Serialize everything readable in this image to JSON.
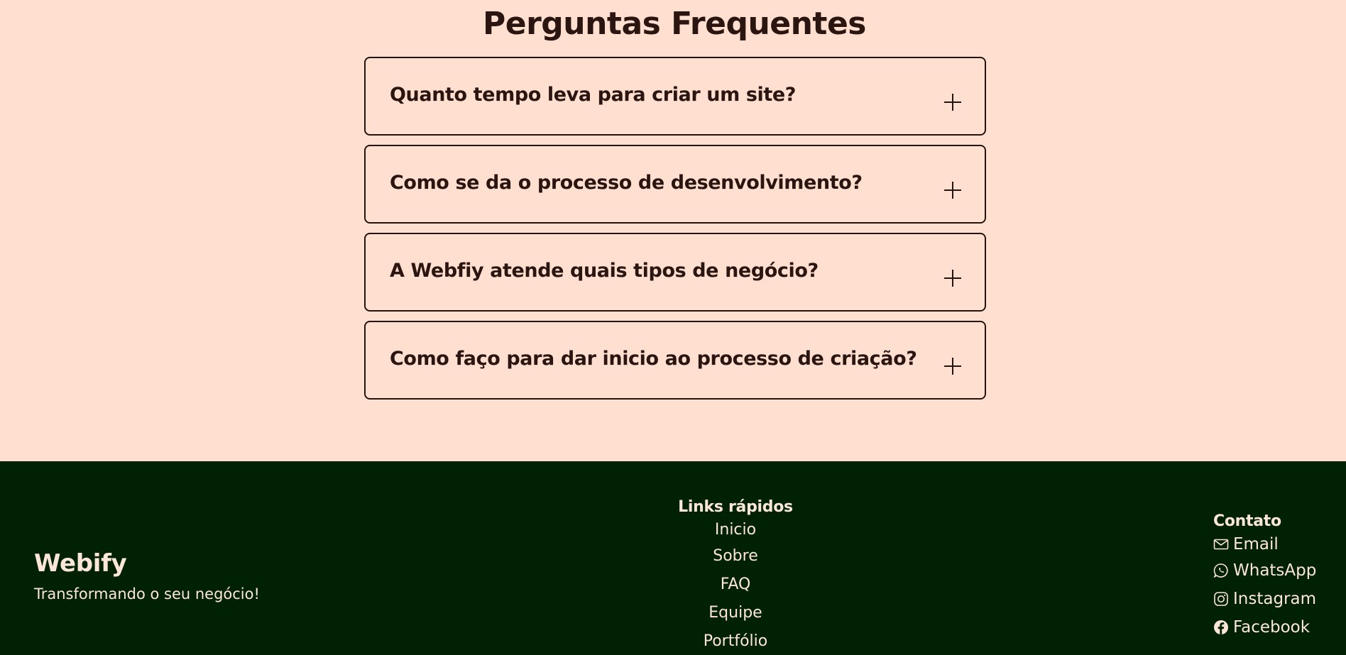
{
  "faq": {
    "title": "Perguntas Frequentes",
    "items": [
      {
        "question": "Quanto tempo leva para criar um site?",
        "icon": "plus-icon"
      },
      {
        "question": "Como se da o processo de desenvolvimento?",
        "icon": "plus-icon"
      },
      {
        "question": "A Webfiy atende quais tipos de negócio?",
        "icon": "plus-icon"
      },
      {
        "question": "Como faço para dar inicio ao processo de criação?",
        "icon": "plus-icon"
      }
    ]
  },
  "footer": {
    "brand": {
      "name": "Webify",
      "tagline": "Transformando o seu negócio!"
    },
    "quick_links": {
      "title": "Links rápidos",
      "items": [
        "Inicio",
        "Sobre",
        "FAQ",
        "Equipe",
        "Portfólio"
      ]
    },
    "contact": {
      "title": "Contato",
      "items": [
        {
          "label": "Email",
          "icon": "envelope-icon"
        },
        {
          "label": "WhatsApp",
          "icon": "whatsapp-icon"
        },
        {
          "label": "Instagram",
          "icon": "instagram-icon"
        },
        {
          "label": "Facebook",
          "icon": "facebook-icon"
        }
      ]
    }
  },
  "colors": {
    "page_background": "#FFDFCF",
    "text_dark": "#2A1510",
    "footer_background": "#002103",
    "footer_text": "#FBE6D8"
  }
}
